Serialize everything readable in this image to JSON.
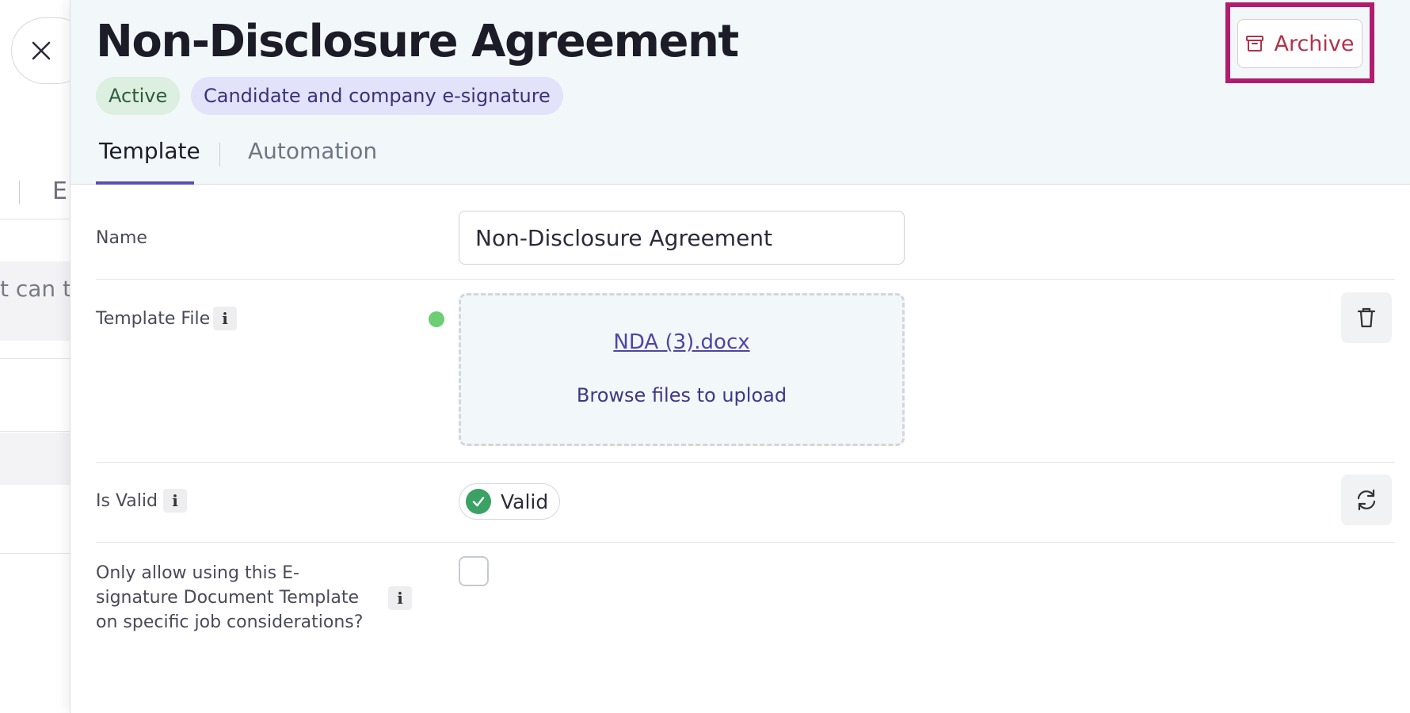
{
  "background": {
    "tab_fragment": "E",
    "row_text_fragment": "t can th"
  },
  "drawer": {
    "title": "Non-Disclosure Agreement",
    "badges": {
      "status": "Active",
      "type": "Candidate and company e-signature"
    },
    "archive_button": {
      "label": "Archive",
      "icon": "archive-box-icon"
    },
    "tabs": [
      {
        "label": "Template",
        "selected": true
      },
      {
        "label": "Automation",
        "selected": false
      }
    ],
    "form": {
      "name": {
        "label": "Name",
        "value": "Non-Disclosure Agreement"
      },
      "template_file": {
        "label": "Template File",
        "info_glyph": "i",
        "file_name": "NDA (3).docx",
        "browse_label": "Browse files to upload",
        "delete_icon": "trash-icon"
      },
      "is_valid": {
        "label": "Is Valid",
        "info_glyph": "i",
        "status": "Valid",
        "refresh_icon": "refresh-icon"
      },
      "restrict": {
        "label": "Only allow using this E-signature Document Template on specific job considerations?",
        "info_glyph": "i",
        "checked": false
      }
    }
  },
  "colors": {
    "accent": "#5b4fb0",
    "archive": "#b0334a",
    "highlight": "#b01c6e",
    "valid_green": "#3aa264",
    "header_bg": "#f2f7f9"
  }
}
